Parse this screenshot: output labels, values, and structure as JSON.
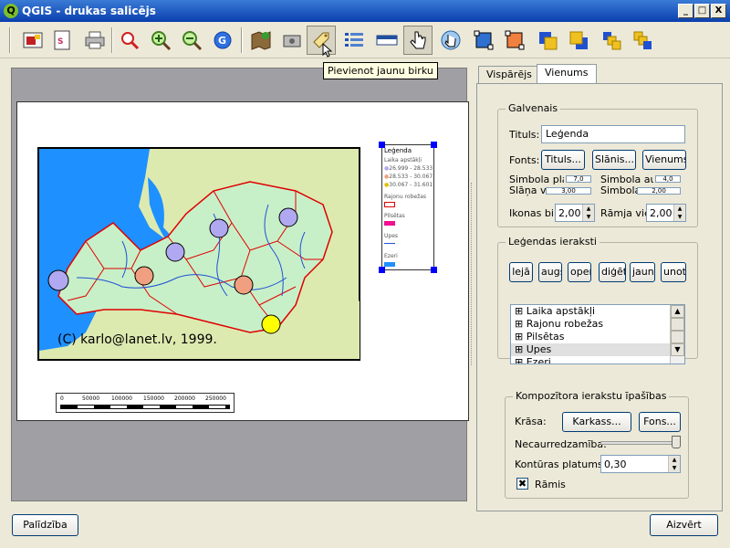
{
  "window": {
    "title": "QGIS - drukas salicējs",
    "minimize": "_",
    "maximize": "□",
    "close": "X",
    "logo": "Q"
  },
  "toolbar": {
    "buttons": [
      {
        "name": "export-image-icon"
      },
      {
        "name": "export-svg-icon"
      },
      {
        "name": "print-icon"
      },
      {
        "name": "zoom-full-icon"
      },
      {
        "name": "zoom-in-icon"
      },
      {
        "name": "zoom-out-icon"
      },
      {
        "name": "refresh-icon"
      },
      {
        "name": "add-map-icon"
      },
      {
        "name": "add-image-icon"
      },
      {
        "name": "add-label-icon"
      },
      {
        "name": "add-legend-icon"
      },
      {
        "name": "add-scalebar-icon"
      },
      {
        "name": "select-move-icon"
      },
      {
        "name": "move-content-icon"
      },
      {
        "name": "group-icon"
      },
      {
        "name": "ungroup-icon"
      },
      {
        "name": "raise-icon"
      },
      {
        "name": "lower-icon"
      },
      {
        "name": "move-top-icon"
      },
      {
        "name": "move-bottom-icon"
      }
    ],
    "tooltip": "Pievienot jaunu birku"
  },
  "map": {
    "copyright": "(C) karlo@lanet.lv, 1999.",
    "colors": {
      "sea": "#1e90ff",
      "land": "#dceab0",
      "border": "#e00000",
      "river": "#1f4fd8"
    }
  },
  "legend_preview": {
    "title": "Leģenda",
    "items": [
      "Laika apstākļi",
      "26.999 - 28.533",
      "28.533 - 30.067",
      "30.067 - 31.601",
      "Rajonu robežas",
      "Pilsētas",
      "Upes",
      "Ezeri"
    ]
  },
  "scalebar": {
    "ticks": [
      "0",
      "50000",
      "100000",
      "150000",
      "200000",
      "250000"
    ]
  },
  "tabs": [
    {
      "label": "Vispārējs"
    },
    {
      "label": "Vienums"
    }
  ],
  "galvenais": {
    "group_title": "Galvenais",
    "title_label": "Tituls:",
    "title_value": "Leģenda",
    "fonts_label": "Fonts:",
    "font_buttons": [
      "Tituls...",
      "Slānis...",
      "Vienums..."
    ],
    "symbol_width_label": "Simbola plat",
    "symbol_width_value": "7,0",
    "symbol_height_label": "Simbola auc",
    "symbol_height_value": "4,0",
    "layer_space_label": "Slāņa v",
    "layer_space_value": "3,00",
    "symbol_space_label": "Simbola",
    "symbol_space_value": "2,00",
    "icon_label": "Ikonas bil",
    "icon_value": "2,00",
    "box_label": "Rāmja vie",
    "box_value": "2,00"
  },
  "entries": {
    "group_title": "Leģendas ieraksti",
    "buttons": [
      "lejā",
      "augšā",
      "open",
      "diģēt",
      "jauns",
      "unot"
    ],
    "items": [
      "Laika apstākļi",
      "Rajonu robežas",
      "Pilsētas",
      "Upes",
      "Ezeri"
    ],
    "selected": "Upes"
  },
  "props": {
    "group_title": "Kompozītora ierakstu īpašības",
    "color_label": "Krāsa:",
    "frame_button": "Karkass...",
    "bg_button": "Fons...",
    "opacity_label": "Necaurredzamība:",
    "opacity_value": 1.0,
    "outline_label": "Kontūras platums",
    "outline_value": "0,30",
    "frame_check_label": "Rāmis",
    "frame_checked": "✖"
  },
  "footer": {
    "help": "Palīdzība",
    "close": "Aizvērt"
  }
}
